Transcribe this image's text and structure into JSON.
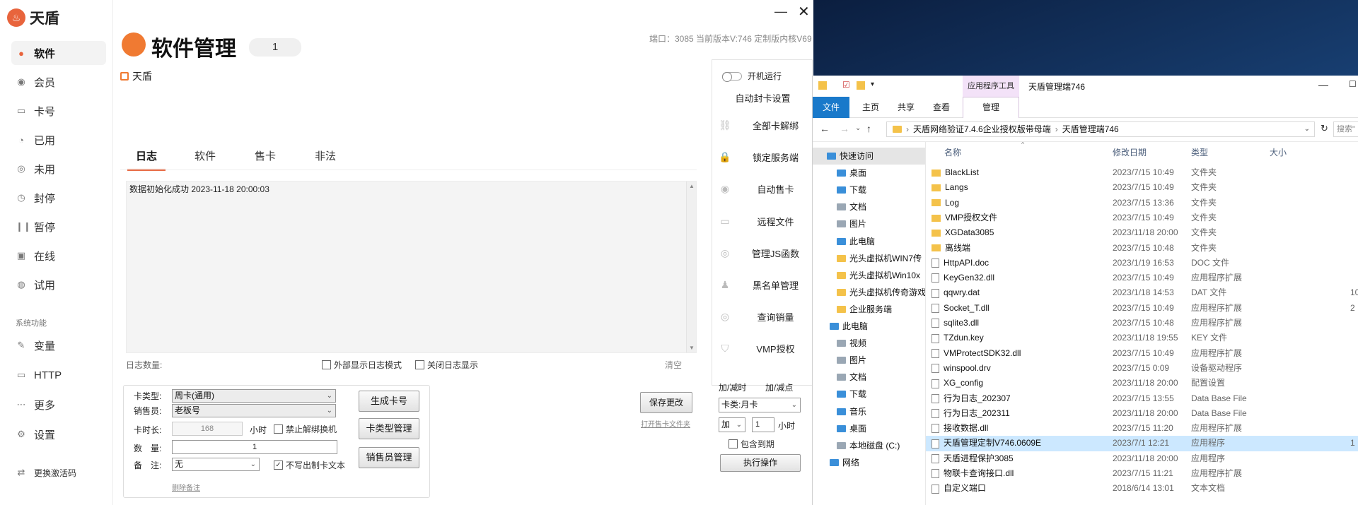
{
  "app": {
    "logo": "天盾",
    "nav": [
      {
        "label": "软件",
        "icon": "software-icon",
        "glyph": "●"
      },
      {
        "label": "会员",
        "icon": "member-icon",
        "glyph": "◉"
      },
      {
        "label": "卡号",
        "icon": "card-icon",
        "glyph": "▭"
      },
      {
        "label": "已用",
        "icon": "used-icon",
        "glyph": "◔"
      },
      {
        "label": "未用",
        "icon": "unused-icon",
        "glyph": "◎"
      },
      {
        "label": "封停",
        "icon": "ban-icon",
        "glyph": "◷"
      },
      {
        "label": "暂停",
        "icon": "pause-icon",
        "glyph": "❙❙"
      },
      {
        "label": "在线",
        "icon": "online-icon",
        "glyph": "▣"
      },
      {
        "label": "试用",
        "icon": "trial-icon",
        "glyph": "◍"
      }
    ],
    "section_title": "系统功能",
    "nav2": [
      {
        "label": "变量",
        "icon": "variable-icon",
        "glyph": "✎"
      },
      {
        "label": "HTTP",
        "icon": "http-icon",
        "glyph": "▭"
      },
      {
        "label": "更多",
        "icon": "more-icon",
        "glyph": "⋯"
      },
      {
        "label": "设置",
        "icon": "settings-icon",
        "glyph": "⚙"
      }
    ],
    "activation": "更换激活码",
    "header": {
      "title": "软件管理",
      "count": "1",
      "info": "端口：3085 当前版本V:746 定制版内核V69"
    },
    "subtitle": "天盾",
    "tabs": [
      "日志",
      "软件",
      "售卡",
      "非法"
    ],
    "log": {
      "line": "数据初始化成功  2023-11-18 20:00:03",
      "count_label": "日志数量:",
      "external_mode": "外部显示日志模式",
      "close_log": "关闭日志显示",
      "clear": "清空"
    },
    "form": {
      "card_type_label": "卡类型:",
      "card_type_value": "周卡(通用)",
      "seller_label": "销售员:",
      "seller_value": "老板号",
      "duration_label": "卡时长:",
      "duration_value": "168",
      "hours": "小时",
      "no_unbind": "禁止解绑换机",
      "qty_label": "数　量:",
      "qty_value": "1",
      "note_label": "备　注:",
      "note_value": "无",
      "no_write": "不写出制卡文本",
      "delete_note": "删除备注",
      "gen_button": "生成卡号",
      "type_button": "卡类型管理",
      "seller_button": "销售员管理",
      "save_button": "保存更改",
      "open_log_folder": "打开售卡文件夹"
    },
    "right": {
      "startup": "开机运行",
      "auto_ban": "自动封卡设置",
      "items": [
        {
          "label": "全部卡解绑",
          "icon": "unlink-icon",
          "glyph": "⛓"
        },
        {
          "label": "锁定服务端",
          "icon": "lock-icon",
          "glyph": "🔒"
        },
        {
          "label": "自动售卡",
          "icon": "auto-sell-icon",
          "glyph": "◉"
        },
        {
          "label": "远程文件",
          "icon": "remote-file-icon",
          "glyph": "▭"
        },
        {
          "label": "管理JS函数",
          "icon": "js-icon",
          "glyph": "◎"
        },
        {
          "label": "黑名单管理",
          "icon": "blacklist-icon",
          "glyph": "♟"
        },
        {
          "label": "查询销量",
          "icon": "query-icon",
          "glyph": "◎"
        },
        {
          "label": "VMP授权",
          "icon": "shield-icon",
          "glyph": "⛉"
        }
      ],
      "add_time": "加/减时",
      "add_point": "加/减点",
      "card_type": "卡类:月卡",
      "op": "加",
      "amount": "1",
      "hours": "小时",
      "include_expired": "包含到期",
      "execute": "执行操作"
    }
  },
  "explorer": {
    "title": "天盾管理端746",
    "ribbon_tabs": [
      "主页",
      "共享",
      "查看"
    ],
    "file_tab": "文件",
    "context_group": "应用程序工具",
    "context_tab": "管理",
    "breadcrumb": [
      "天盾网络验证7.4.6企业授权版带母端",
      "天盾管理端746"
    ],
    "search": "搜索\"",
    "columns": [
      "名称",
      "修改日期",
      "类型",
      "大小"
    ],
    "nav": [
      {
        "label": "快速访问",
        "kind": "blue"
      },
      {
        "label": "桌面",
        "kind": "blue"
      },
      {
        "label": "下载",
        "kind": "blue"
      },
      {
        "label": "文档",
        "kind": "gray"
      },
      {
        "label": "图片",
        "kind": "gray"
      },
      {
        "label": "此电脑",
        "kind": "blue"
      },
      {
        "label": "光头虚拟机WIN7传",
        "kind": "yellow"
      },
      {
        "label": "光头虚拟机Win10x",
        "kind": "yellow"
      },
      {
        "label": "光头虚拟机传奇游戏",
        "kind": "yellow"
      },
      {
        "label": "企业服务端",
        "kind": "yellow"
      },
      {
        "label": "此电脑",
        "kind": "blue"
      },
      {
        "label": "视频",
        "kind": "gray"
      },
      {
        "label": "图片",
        "kind": "gray"
      },
      {
        "label": "文档",
        "kind": "gray"
      },
      {
        "label": "下载",
        "kind": "blue"
      },
      {
        "label": "音乐",
        "kind": "blue"
      },
      {
        "label": "桌面",
        "kind": "blue"
      },
      {
        "label": "本地磁盘 (C:)",
        "kind": "gray"
      },
      {
        "label": "网络",
        "kind": "blue"
      }
    ],
    "files": [
      {
        "name": "BlackList",
        "date": "2023/7/15 10:49",
        "type": "文件夹",
        "size": "",
        "folder": true
      },
      {
        "name": "Langs",
        "date": "2023/7/15 10:49",
        "type": "文件夹",
        "size": "",
        "folder": true
      },
      {
        "name": "Log",
        "date": "2023/7/15 13:36",
        "type": "文件夹",
        "size": "",
        "folder": true
      },
      {
        "name": "VMP授权文件",
        "date": "2023/7/15 10:49",
        "type": "文件夹",
        "size": "",
        "folder": true
      },
      {
        "name": "XGData3085",
        "date": "2023/11/18 20:00",
        "type": "文件夹",
        "size": "",
        "folder": true
      },
      {
        "name": "离线端",
        "date": "2023/7/15 10:48",
        "type": "文件夹",
        "size": "",
        "folder": true
      },
      {
        "name": "HttpAPI.doc",
        "date": "2023/1/19 16:53",
        "type": "DOC 文件",
        "size": "",
        "folder": false
      },
      {
        "name": "KeyGen32.dll",
        "date": "2023/7/15 10:49",
        "type": "应用程序扩展",
        "size": "",
        "folder": false
      },
      {
        "name": "qqwry.dat",
        "date": "2023/1/18 14:53",
        "type": "DAT 文件",
        "size": "10",
        "folder": false
      },
      {
        "name": "Socket_T.dll",
        "date": "2023/7/15 10:49",
        "type": "应用程序扩展",
        "size": "2",
        "folder": false
      },
      {
        "name": "sqlite3.dll",
        "date": "2023/7/15 10:48",
        "type": "应用程序扩展",
        "size": "",
        "folder": false
      },
      {
        "name": "TZdun.key",
        "date": "2023/11/18 19:55",
        "type": "KEY 文件",
        "size": "",
        "folder": false
      },
      {
        "name": "VMProtectSDK32.dll",
        "date": "2023/7/15 10:49",
        "type": "应用程序扩展",
        "size": "",
        "folder": false
      },
      {
        "name": "winspool.drv",
        "date": "2023/7/15 0:09",
        "type": "设备驱动程序",
        "size": "",
        "folder": false
      },
      {
        "name": "XG_config",
        "date": "2023/11/18 20:00",
        "type": "配置设置",
        "size": "",
        "folder": false
      },
      {
        "name": "行为日志_202307",
        "date": "2023/7/15 13:55",
        "type": "Data Base File",
        "size": "",
        "folder": false
      },
      {
        "name": "行为日志_202311",
        "date": "2023/11/18 20:00",
        "type": "Data Base File",
        "size": "",
        "folder": false
      },
      {
        "name": "接收数据.dll",
        "date": "2023/7/15 11:20",
        "type": "应用程序扩展",
        "size": "",
        "folder": false
      },
      {
        "name": "天盾管理定制V746.0609E",
        "date": "2023/7/1 12:21",
        "type": "应用程序",
        "size": "1",
        "folder": false,
        "selected": true
      },
      {
        "name": "天盾进程保护3085",
        "date": "2023/11/18 20:00",
        "type": "应用程序",
        "size": "",
        "folder": false
      },
      {
        "name": "物联卡查询接口.dll",
        "date": "2023/7/15 11:21",
        "type": "应用程序扩展",
        "size": "",
        "folder": false
      },
      {
        "name": "自定义端口",
        "date": "2018/6/14 13:01",
        "type": "文本文档",
        "size": "",
        "folder": false
      }
    ]
  }
}
